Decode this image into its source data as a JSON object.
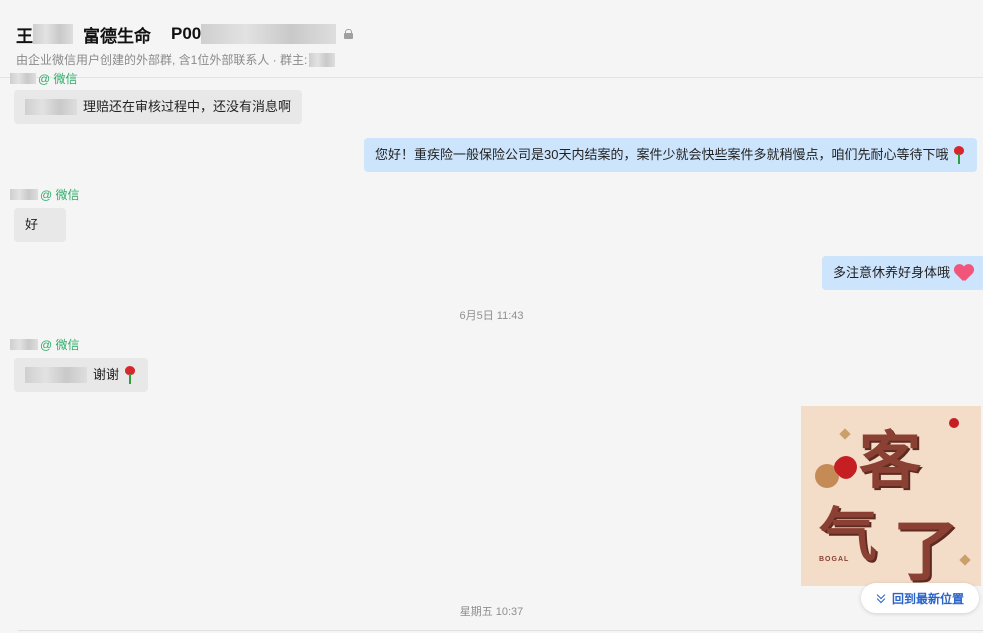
{
  "header": {
    "title_prefix": "王",
    "title_name": "富德生命",
    "title_code": "P00",
    "subtitle": "由企业微信用户创建的外部群, 含1位外部联系人 · 群主:"
  },
  "messages": [
    {
      "id": "m1",
      "sender_suffix": "@ 微信",
      "text": "理赔还在审核过程中，还没有消息啊"
    },
    {
      "id": "m2",
      "text": "您好！重疾险一般保险公司是30天内结案的，案件少就会快些案件多就稍慢点，咱们先耐心等待下哦",
      "emoji": "rose-icon"
    },
    {
      "id": "m3",
      "sender_suffix": "@ 微信",
      "text": "好"
    },
    {
      "id": "m4",
      "text": "多注意休养好身体哦",
      "emoji": "heart-icon"
    },
    {
      "id": "m5",
      "sender_suffix": "@ 微信",
      "text": "谢谢",
      "emoji": "rose-icon"
    }
  ],
  "timestamps": {
    "t1": "6月5日 11:43",
    "t2": "星期五 10:37"
  },
  "sticker": {
    "char1": "客",
    "char2": "气",
    "char3": "了",
    "brand": "BOGAL"
  },
  "latest_button": {
    "label": "回到最新位置",
    "icon": "chevrons-down-icon"
  },
  "colors": {
    "incoming_bubble": "#e8e8e8",
    "outgoing_bubble": "#cce4fc",
    "sender_green": "#2aae67",
    "link_blue": "#2a63c9"
  }
}
